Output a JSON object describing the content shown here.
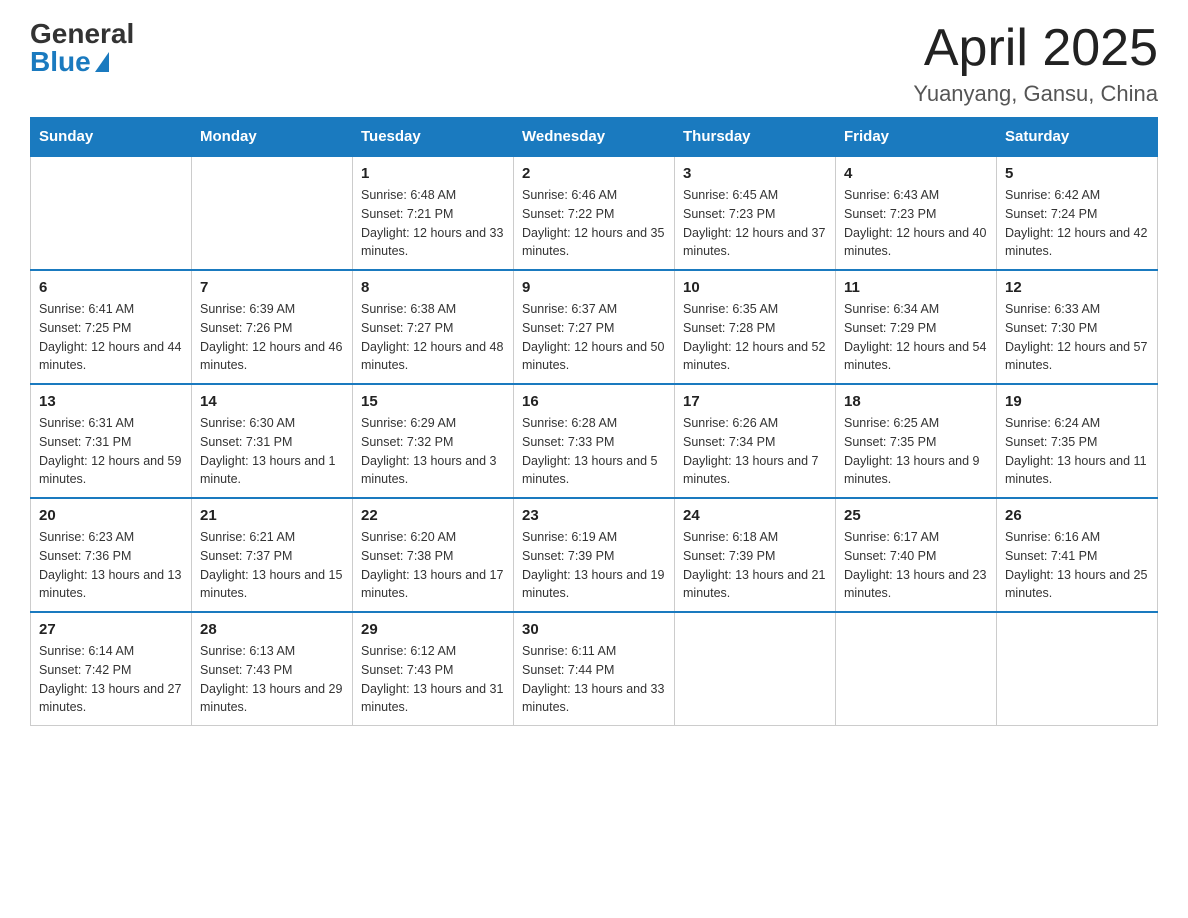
{
  "logo": {
    "general": "General",
    "blue": "Blue"
  },
  "title": {
    "month_year": "April 2025",
    "location": "Yuanyang, Gansu, China"
  },
  "days_of_week": [
    "Sunday",
    "Monday",
    "Tuesday",
    "Wednesday",
    "Thursday",
    "Friday",
    "Saturday"
  ],
  "weeks": [
    [
      {
        "day": "",
        "sunrise": "",
        "sunset": "",
        "daylight": ""
      },
      {
        "day": "",
        "sunrise": "",
        "sunset": "",
        "daylight": ""
      },
      {
        "day": "1",
        "sunrise": "Sunrise: 6:48 AM",
        "sunset": "Sunset: 7:21 PM",
        "daylight": "Daylight: 12 hours and 33 minutes."
      },
      {
        "day": "2",
        "sunrise": "Sunrise: 6:46 AM",
        "sunset": "Sunset: 7:22 PM",
        "daylight": "Daylight: 12 hours and 35 minutes."
      },
      {
        "day": "3",
        "sunrise": "Sunrise: 6:45 AM",
        "sunset": "Sunset: 7:23 PM",
        "daylight": "Daylight: 12 hours and 37 minutes."
      },
      {
        "day": "4",
        "sunrise": "Sunrise: 6:43 AM",
        "sunset": "Sunset: 7:23 PM",
        "daylight": "Daylight: 12 hours and 40 minutes."
      },
      {
        "day": "5",
        "sunrise": "Sunrise: 6:42 AM",
        "sunset": "Sunset: 7:24 PM",
        "daylight": "Daylight: 12 hours and 42 minutes."
      }
    ],
    [
      {
        "day": "6",
        "sunrise": "Sunrise: 6:41 AM",
        "sunset": "Sunset: 7:25 PM",
        "daylight": "Daylight: 12 hours and 44 minutes."
      },
      {
        "day": "7",
        "sunrise": "Sunrise: 6:39 AM",
        "sunset": "Sunset: 7:26 PM",
        "daylight": "Daylight: 12 hours and 46 minutes."
      },
      {
        "day": "8",
        "sunrise": "Sunrise: 6:38 AM",
        "sunset": "Sunset: 7:27 PM",
        "daylight": "Daylight: 12 hours and 48 minutes."
      },
      {
        "day": "9",
        "sunrise": "Sunrise: 6:37 AM",
        "sunset": "Sunset: 7:27 PM",
        "daylight": "Daylight: 12 hours and 50 minutes."
      },
      {
        "day": "10",
        "sunrise": "Sunrise: 6:35 AM",
        "sunset": "Sunset: 7:28 PM",
        "daylight": "Daylight: 12 hours and 52 minutes."
      },
      {
        "day": "11",
        "sunrise": "Sunrise: 6:34 AM",
        "sunset": "Sunset: 7:29 PM",
        "daylight": "Daylight: 12 hours and 54 minutes."
      },
      {
        "day": "12",
        "sunrise": "Sunrise: 6:33 AM",
        "sunset": "Sunset: 7:30 PM",
        "daylight": "Daylight: 12 hours and 57 minutes."
      }
    ],
    [
      {
        "day": "13",
        "sunrise": "Sunrise: 6:31 AM",
        "sunset": "Sunset: 7:31 PM",
        "daylight": "Daylight: 12 hours and 59 minutes."
      },
      {
        "day": "14",
        "sunrise": "Sunrise: 6:30 AM",
        "sunset": "Sunset: 7:31 PM",
        "daylight": "Daylight: 13 hours and 1 minute."
      },
      {
        "day": "15",
        "sunrise": "Sunrise: 6:29 AM",
        "sunset": "Sunset: 7:32 PM",
        "daylight": "Daylight: 13 hours and 3 minutes."
      },
      {
        "day": "16",
        "sunrise": "Sunrise: 6:28 AM",
        "sunset": "Sunset: 7:33 PM",
        "daylight": "Daylight: 13 hours and 5 minutes."
      },
      {
        "day": "17",
        "sunrise": "Sunrise: 6:26 AM",
        "sunset": "Sunset: 7:34 PM",
        "daylight": "Daylight: 13 hours and 7 minutes."
      },
      {
        "day": "18",
        "sunrise": "Sunrise: 6:25 AM",
        "sunset": "Sunset: 7:35 PM",
        "daylight": "Daylight: 13 hours and 9 minutes."
      },
      {
        "day": "19",
        "sunrise": "Sunrise: 6:24 AM",
        "sunset": "Sunset: 7:35 PM",
        "daylight": "Daylight: 13 hours and 11 minutes."
      }
    ],
    [
      {
        "day": "20",
        "sunrise": "Sunrise: 6:23 AM",
        "sunset": "Sunset: 7:36 PM",
        "daylight": "Daylight: 13 hours and 13 minutes."
      },
      {
        "day": "21",
        "sunrise": "Sunrise: 6:21 AM",
        "sunset": "Sunset: 7:37 PM",
        "daylight": "Daylight: 13 hours and 15 minutes."
      },
      {
        "day": "22",
        "sunrise": "Sunrise: 6:20 AM",
        "sunset": "Sunset: 7:38 PM",
        "daylight": "Daylight: 13 hours and 17 minutes."
      },
      {
        "day": "23",
        "sunrise": "Sunrise: 6:19 AM",
        "sunset": "Sunset: 7:39 PM",
        "daylight": "Daylight: 13 hours and 19 minutes."
      },
      {
        "day": "24",
        "sunrise": "Sunrise: 6:18 AM",
        "sunset": "Sunset: 7:39 PM",
        "daylight": "Daylight: 13 hours and 21 minutes."
      },
      {
        "day": "25",
        "sunrise": "Sunrise: 6:17 AM",
        "sunset": "Sunset: 7:40 PM",
        "daylight": "Daylight: 13 hours and 23 minutes."
      },
      {
        "day": "26",
        "sunrise": "Sunrise: 6:16 AM",
        "sunset": "Sunset: 7:41 PM",
        "daylight": "Daylight: 13 hours and 25 minutes."
      }
    ],
    [
      {
        "day": "27",
        "sunrise": "Sunrise: 6:14 AM",
        "sunset": "Sunset: 7:42 PM",
        "daylight": "Daylight: 13 hours and 27 minutes."
      },
      {
        "day": "28",
        "sunrise": "Sunrise: 6:13 AM",
        "sunset": "Sunset: 7:43 PM",
        "daylight": "Daylight: 13 hours and 29 minutes."
      },
      {
        "day": "29",
        "sunrise": "Sunrise: 6:12 AM",
        "sunset": "Sunset: 7:43 PM",
        "daylight": "Daylight: 13 hours and 31 minutes."
      },
      {
        "day": "30",
        "sunrise": "Sunrise: 6:11 AM",
        "sunset": "Sunset: 7:44 PM",
        "daylight": "Daylight: 13 hours and 33 minutes."
      },
      {
        "day": "",
        "sunrise": "",
        "sunset": "",
        "daylight": ""
      },
      {
        "day": "",
        "sunrise": "",
        "sunset": "",
        "daylight": ""
      },
      {
        "day": "",
        "sunrise": "",
        "sunset": "",
        "daylight": ""
      }
    ]
  ]
}
